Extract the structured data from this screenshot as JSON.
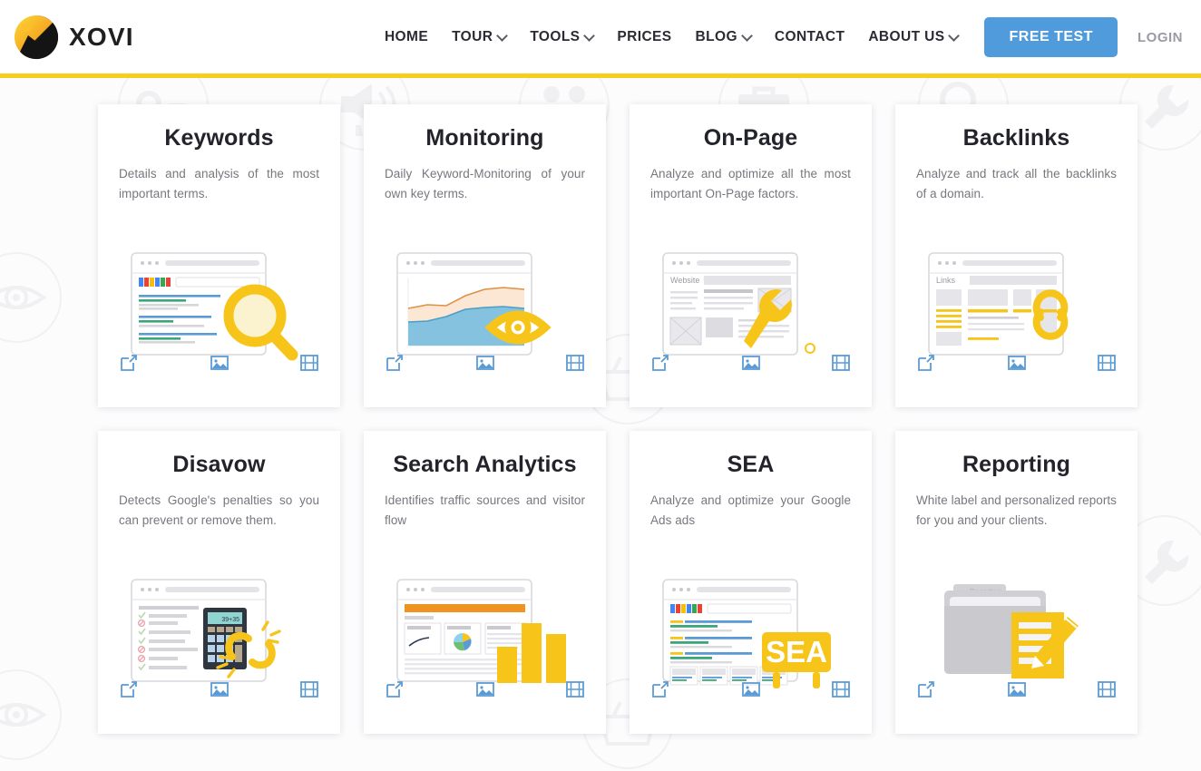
{
  "header": {
    "brand": {
      "name": "XOVI",
      "logo_icon": "xovi-logo-icon"
    },
    "nav": [
      {
        "label": "HOME",
        "has_dropdown": false
      },
      {
        "label": "TOUR",
        "has_dropdown": true
      },
      {
        "label": "TOOLS",
        "has_dropdown": true
      },
      {
        "label": "PRICES",
        "has_dropdown": false
      },
      {
        "label": "BLOG",
        "has_dropdown": true
      },
      {
        "label": "CONTACT",
        "has_dropdown": false
      },
      {
        "label": "ABOUT US",
        "has_dropdown": true
      }
    ],
    "cta_label": "FREE TEST",
    "login_label": "LOGIN",
    "accent_color": "#f8ce1c",
    "cta_color": "#4f9bdb"
  },
  "cards": [
    {
      "title": "Keywords",
      "description": "Details and analysis of the most important terms.",
      "illustration": "serp-list-with-magnifier-illustration",
      "actions": [
        {
          "name": "external-link-icon",
          "label": "Open tool"
        },
        {
          "name": "image-icon",
          "label": "Screenshots"
        },
        {
          "name": "film-icon",
          "label": "Video"
        }
      ]
    },
    {
      "title": "Monitoring",
      "description": "Daily Keyword-Monitoring of your own key terms.",
      "illustration": "area-chart-with-eye-illustration",
      "actions": [
        {
          "name": "external-link-icon",
          "label": "Open tool"
        },
        {
          "name": "image-icon",
          "label": "Screenshots"
        },
        {
          "name": "film-icon",
          "label": "Video"
        }
      ]
    },
    {
      "title": "On-Page",
      "description": "Analyze and optimize all the most important On-Page factors.",
      "illustration": "website-wireframe-with-wrench-illustration",
      "illustration_label": "Website",
      "actions": [
        {
          "name": "external-link-icon",
          "label": "Open tool"
        },
        {
          "name": "image-icon",
          "label": "Screenshots"
        },
        {
          "name": "film-icon",
          "label": "Video"
        }
      ]
    },
    {
      "title": "Backlinks",
      "description": "Analyze and track all the backlinks of a domain.",
      "illustration": "links-page-with-chain-illustration",
      "illustration_label": "Links",
      "actions": [
        {
          "name": "external-link-icon",
          "label": "Open tool"
        },
        {
          "name": "image-icon",
          "label": "Screenshots"
        },
        {
          "name": "film-icon",
          "label": "Video"
        }
      ]
    },
    {
      "title": "Disavow",
      "description": "Detects Google's penalties so you can prevent or remove them.",
      "illustration": "checklist-calculator-broken-link-illustration",
      "illustration_label": "39+35",
      "actions": [
        {
          "name": "external-link-icon",
          "label": "Open tool"
        },
        {
          "name": "image-icon",
          "label": "Screenshots"
        },
        {
          "name": "film-icon",
          "label": "Video"
        }
      ]
    },
    {
      "title": "Search Analytics",
      "description": "Identifies traffic sources and visitor flow",
      "illustration": "dashboard-with-bar-chart-illustration",
      "actions": [
        {
          "name": "external-link-icon",
          "label": "Open tool"
        },
        {
          "name": "image-icon",
          "label": "Screenshots"
        },
        {
          "name": "film-icon",
          "label": "Video"
        }
      ]
    },
    {
      "title": "SEA",
      "description": "Analyze and optimize your Google Ads ads",
      "illustration": "serp-ads-with-sea-sign-illustration",
      "illustration_label": "SEA",
      "actions": [
        {
          "name": "external-link-icon",
          "label": "Open tool"
        },
        {
          "name": "image-icon",
          "label": "Screenshots"
        },
        {
          "name": "film-icon",
          "label": "Video"
        }
      ]
    },
    {
      "title": "Reporting",
      "description": "White label and personalized reports for you and your clients.",
      "illustration": "folder-with-pencil-report-illustration",
      "illustration_label": "Reporting",
      "actions": [
        {
          "name": "external-link-icon",
          "label": "Open tool"
        },
        {
          "name": "image-icon",
          "label": "Screenshots"
        },
        {
          "name": "film-icon",
          "label": "Video"
        }
      ]
    }
  ],
  "background_watermarks": [
    {
      "icon": "key-icon"
    },
    {
      "icon": "megaphone-icon"
    },
    {
      "icon": "people-icon"
    },
    {
      "icon": "briefcase-icon"
    },
    {
      "icon": "magnifier-icon"
    },
    {
      "icon": "wrench-icon"
    },
    {
      "icon": "eye-icon"
    },
    {
      "icon": "eye-icon"
    },
    {
      "icon": "basket-icon"
    }
  ],
  "colors": {
    "yellow": "#f8ce1c",
    "blue_action": "#4f9bdb",
    "title": "#23232b",
    "body_text": "#77777f",
    "page_bg": "#fcfcfd"
  }
}
